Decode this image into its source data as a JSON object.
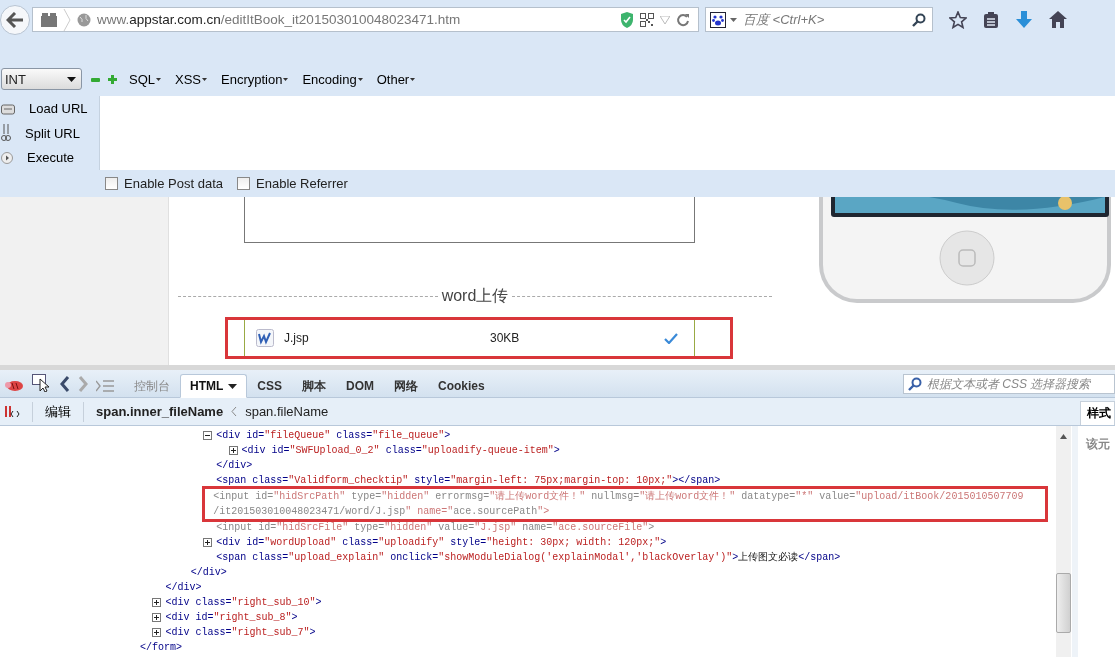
{
  "browser": {
    "url": "www.**appstar.com.cn**/editItBook_it201503010048023471.htm",
    "search_placeholder": "百度 <Ctrl+K>"
  },
  "hackbar": {
    "select_value": "INT",
    "menus": [
      "SQL",
      "XSS",
      "Encryption",
      "Encoding",
      "Other"
    ],
    "actions": [
      "Load URL",
      "Split URL",
      "Execute"
    ],
    "options": [
      {
        "label": "Enable Post data",
        "checked": false
      },
      {
        "label": "Enable Referrer",
        "checked": false
      }
    ]
  },
  "page": {
    "section_title": "word上传",
    "file": {
      "name": "J.jsp",
      "size": "30KB",
      "done": true,
      "highlighted": true
    }
  },
  "devtools": {
    "tabs": [
      {
        "label": "控制台",
        "selected": false,
        "disabled": true,
        "menu": false
      },
      {
        "label": "HTML",
        "selected": true,
        "disabled": false,
        "menu": true
      },
      {
        "label": "CSS",
        "selected": false,
        "disabled": false,
        "menu": false
      },
      {
        "label": "脚本",
        "selected": false,
        "disabled": false,
        "menu": false
      },
      {
        "label": "DOM",
        "selected": false,
        "disabled": false,
        "menu": false
      },
      {
        "label": "网络",
        "selected": false,
        "disabled": false,
        "menu": false
      },
      {
        "label": "Cookies",
        "selected": false,
        "disabled": false,
        "menu": false
      }
    ],
    "search_placeholder": "根据文本或者 CSS 选择器搜索",
    "edit_button": "编辑",
    "breadcrumbs": [
      {
        "label": "span.inner_fileName",
        "selected": true
      },
      {
        "label": "span.fileName",
        "selected": false
      }
    ],
    "side_tabs": [
      {
        "label": "样式",
        "selected": true
      }
    ],
    "side_text": "该元",
    "dom_tree": [
      {
        "children": [
          {
            "children": [
              {
                "children": [
                  {
                    "open": [
                      "<div id=\"fileQueue\" class=\"file_queue\">"
                    ],
                    "expanded": true,
                    "dimmed": false,
                    "highlighted": false,
                    "children": [
                      {
                        "open": [
                          "<div id=\"SWFUpload_0_2\" class=\"uploadify-queue-item\">"
                        ],
                        "expanded": false,
                        "dimmed": false,
                        "highlighted": false
                      }
                    ],
                    "close": "</div>"
                  },
                  {
                    "open": [
                      "<span class=\"Validform_checktip\" style=\"margin-left: 75px;margin-top: 10px;\"></span>"
                    ],
                    "dimmed": false,
                    "highlighted": false
                  },
                  {
                    "open": [
                      "<input id=\"hidSrcPath\" type=\"hidden\" errormsg=\"请上传word文件！\" nullmsg=\"请上传word文件！\" datatype=\"*\" value=\"upload/itBook/2015010507709",
                      "/it201503010048023471/word/J.jsp\" name=\"ace.sourcePath\">"
                    ],
                    "dimmed": true,
                    "highlighted": true
                  },
                  {
                    "open": [
                      "<input id=\"hidSrcFile\" type=\"hidden\" value=\"J.jsp\" name=\"ace.sourceFile\">"
                    ],
                    "dimmed": true,
                    "highlighted": false
                  },
                  {
                    "open": [
                      "<div id=\"wordUpload\" class=\"uploadify\" style=\"height: 30px; width: 120px;\">"
                    ],
                    "expanded": false,
                    "dimmed": false,
                    "highlighted": false
                  },
                  {
                    "open": [
                      "<span class=\"upload_explain\" onclick=\"showModuleDialog('explainModal','blackOverlay')\">上传图文必读</span>"
                    ],
                    "dimmed": false,
                    "highlighted": false
                  }
                ],
                "close": "</div>"
              }
            ],
            "close": "</div>"
          },
          {
            "open": [
              "<div class=\"right_sub_10\">"
            ],
            "expanded": false,
            "dimmed": false,
            "highlighted": false
          },
          {
            "open": [
              "<div id=\"right_sub_8\">"
            ],
            "expanded": false,
            "dimmed": false,
            "highlighted": false
          },
          {
            "open": [
              "<div class=\"right_sub_7\">"
            ],
            "expanded": false,
            "dimmed": false,
            "highlighted": false
          }
        ],
        "close": "</form>"
      }
    ]
  }
}
